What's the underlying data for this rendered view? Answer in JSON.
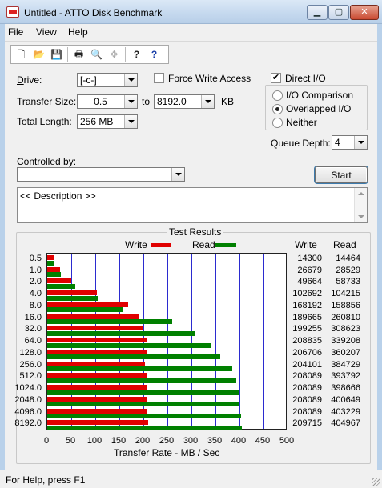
{
  "window": {
    "title": "Untitled - ATTO Disk Benchmark",
    "min_symbol": "▁",
    "max_symbol": "▢",
    "close_symbol": "✕"
  },
  "menu": {
    "items": [
      "File",
      "View",
      "Help"
    ]
  },
  "toolbar": {
    "icons": [
      "new-document-icon",
      "open-folder-icon",
      "save-icon",
      "print-icon",
      "print-preview-icon",
      "move-icon",
      "help-icon",
      "context-help-icon"
    ],
    "glyphs": [
      "🗋",
      "📂",
      "💾",
      "🖶",
      "🔍",
      "✥",
      "?",
      "?"
    ]
  },
  "settings": {
    "drive_label": "Drive:",
    "drive_value": "[-c-]",
    "force_write_label": "Force Write Access",
    "force_write_checked": false,
    "direct_io_label": "Direct I/O",
    "direct_io_checked": true,
    "direct_io_mark": "✔",
    "transfer_size_label": "Transfer Size:",
    "transfer_from": "0.5",
    "to_label": "to",
    "transfer_to": "8192.0",
    "kb_label": "KB",
    "total_length_label": "Total Length:",
    "total_length": "256 MB",
    "io_options": [
      "I/O Comparison",
      "Overlapped I/O",
      "Neither"
    ],
    "io_selected": "Overlapped I/O",
    "queue_depth_label": "Queue Depth:",
    "queue_depth": "4",
    "controlled_by_label": "Controlled by:",
    "controlled_by_value": "",
    "start_button": "Start",
    "description": "<< Description >>"
  },
  "chart_data": {
    "type": "bar",
    "title": "Test Results",
    "xlabel": "Transfer Rate - MB / Sec",
    "xlim": [
      0,
      500
    ],
    "xticks": [
      "0",
      "50",
      "100",
      "150",
      "200",
      "250",
      "300",
      "350",
      "400",
      "450",
      "500"
    ],
    "categories": [
      "0.5",
      "1.0",
      "2.0",
      "4.0",
      "8.0",
      "16.0",
      "32.0",
      "64.0",
      "128.0",
      "256.0",
      "512.0",
      "1024.0",
      "2048.0",
      "4096.0",
      "8192.0"
    ],
    "series": [
      {
        "name": "Write",
        "color": "#e00000",
        "values": [
          14300,
          26679,
          49664,
          102692,
          168192,
          189665,
          199255,
          208835,
          206706,
          204101,
          208089,
          208089,
          208089,
          208089,
          209715
        ]
      },
      {
        "name": "Read",
        "color": "#008000",
        "values": [
          14464,
          28529,
          58733,
          104215,
          158856,
          260810,
          308623,
          339208,
          360207,
          384729,
          393792,
          398666,
          400649,
          403229,
          404967
        ]
      }
    ],
    "table_headers": [
      "Write",
      "Read"
    ],
    "legend": "top",
    "grid": true
  },
  "status": {
    "text": "For Help, press F1"
  }
}
